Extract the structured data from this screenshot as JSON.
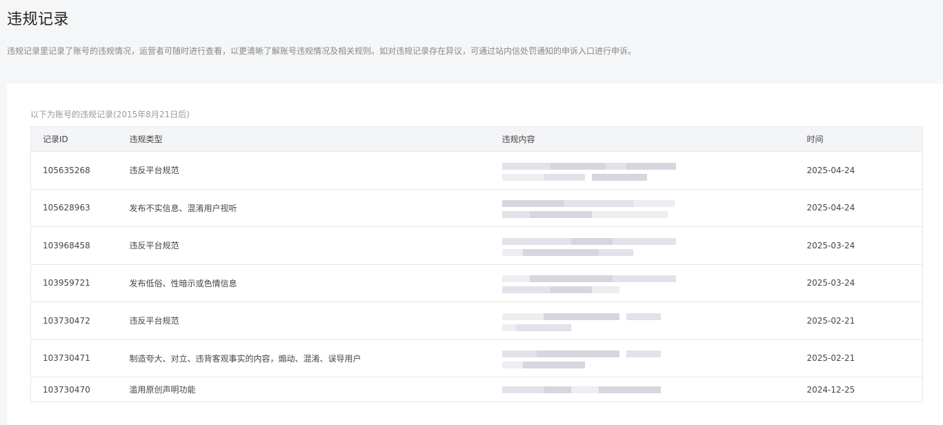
{
  "header": {
    "title": "违规记录",
    "description": "违规记录里记录了账号的违规情况，运营者可随时进行查看，以更清晰了解账号违规情况及相关规则。如对违规记录存在异议，可通过站内信处罚通知的申诉入口进行申诉。"
  },
  "card": {
    "subtitle": "以下为账号的违规记录(2015年8月21日后)"
  },
  "table": {
    "columns": {
      "id": "记录ID",
      "type": "违规类型",
      "content": "违规内容",
      "time": "时间"
    },
    "rows": [
      {
        "id": "105635268",
        "type": "违反平台规范",
        "content": "",
        "time": "2025-04-24"
      },
      {
        "id": "105628963",
        "type": "发布不实信息、混淆用户视听",
        "content": "",
        "time": "2025-04-24"
      },
      {
        "id": "103968458",
        "type": "违反平台规范",
        "content": "",
        "time": "2025-03-24"
      },
      {
        "id": "103959721",
        "type": "发布低俗、性暗示或色情信息",
        "content": "",
        "time": "2025-03-24"
      },
      {
        "id": "103730472",
        "type": "违反平台规范",
        "content": "",
        "time": "2025-02-21"
      },
      {
        "id": "103730471",
        "type": "制造夸大、对立、违背客观事实的内容，煽动、混淆、误导用户",
        "content": "",
        "time": "2025-02-21"
      },
      {
        "id": "103730470",
        "type": "滥用原创声明功能",
        "content": "",
        "time": "2024-12-25"
      }
    ]
  },
  "colors": {
    "page_background": "#f5f6f7",
    "card_background": "#ffffff",
    "header_row_background": "#f4f5f7",
    "border": "#e7e7e7",
    "redaction": "#e2e3ea"
  }
}
